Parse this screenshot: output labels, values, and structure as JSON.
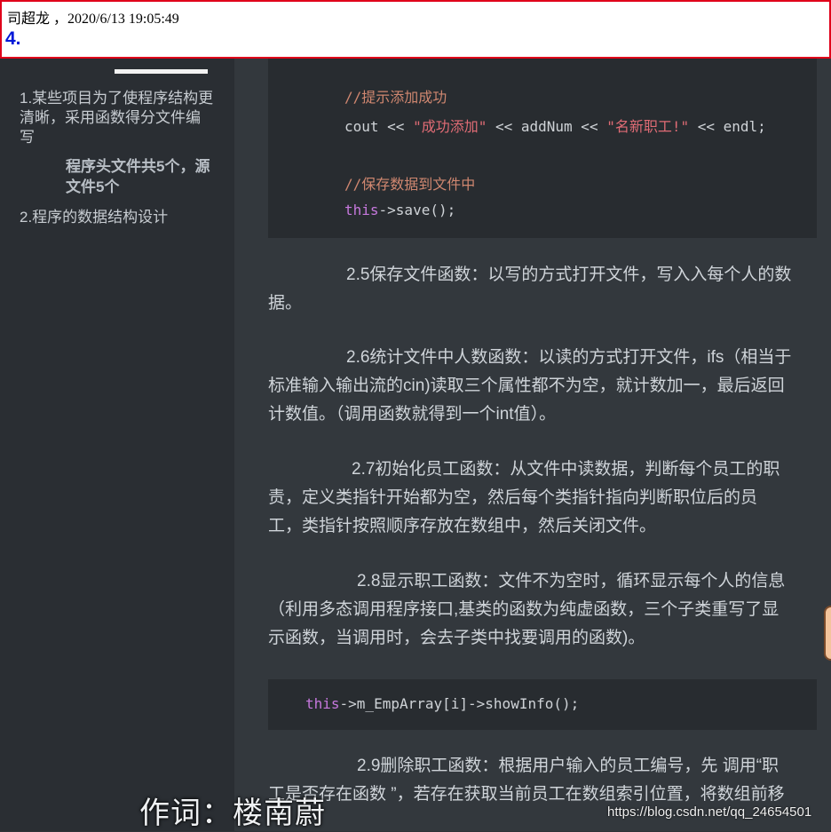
{
  "header": {
    "meta": "司超龙 ，2020/6/13 19:05:49",
    "number": "4."
  },
  "sidebar": {
    "items": [
      {
        "label": "1.某些项目为了使程序结构更清晰，采用函数得分文件编写"
      },
      {
        "label": "程序头文件共5个，源文件5个"
      },
      {
        "label": "2.程序的数据结构设计"
      }
    ]
  },
  "code1": {
    "comment1": "//提示添加成功",
    "line_cout_a": "cout << ",
    "str1": "\"成功添加\"",
    "line_cout_b": " << addNum << ",
    "str2": "\"名新职工!\"",
    "line_cout_c": " << endl;",
    "comment2": "//保存数据到文件中",
    "kw_this": "this",
    "save_call": "->save();"
  },
  "paragraphs": {
    "p25": [
      "2.5保存文件函数：以写的方式打开文件，写入入每个人的数",
      "据。"
    ],
    "p26": [
      "2.6统计文件中人数函数：以读的方式打开文件，ifs（相当于",
      "标准输入输出流的cin)读取三个属性都不为空，就计数加一，最后返回",
      "计数值。（调用函数就得到一个int值）。"
    ],
    "p27": [
      "2.7初始化员工函数：从文件中读数据，判断每个员工的职",
      "责，定义类指针开始都为空，然后每个类指针指向判断职位后的员",
      "工，类指针按照顺序存放在数组中，然后关闭文件。"
    ],
    "p28": [
      "2.8显示职工函数：文件不为空时，循环显示每个人的信息",
      "（利用多态调用程序接口,基类的函数为纯虚函数，三个子类重写了显",
      "示函数，当调用时，会去子类中找要调用的函数)。"
    ],
    "p29": [
      "2.9删除职工函数：根据用户输入的员工编号，先 调用“职",
      "工是否存在函数 ”，若存在获取当前员工在数组索引位置，将数组前移"
    ]
  },
  "code2": {
    "kw_this": "this",
    "call": "->m_EmpArray[i]->showInfo();"
  },
  "overlay": {
    "lyric": "作词：楼南蔚",
    "watermark": "https://blog.csdn.net/qq_24654501"
  },
  "colors": {
    "header_border": "#e0001a",
    "header_number": "#0018d8",
    "comment": "#d08770",
    "string": "#e06c75",
    "keyword": "#c678dd"
  }
}
